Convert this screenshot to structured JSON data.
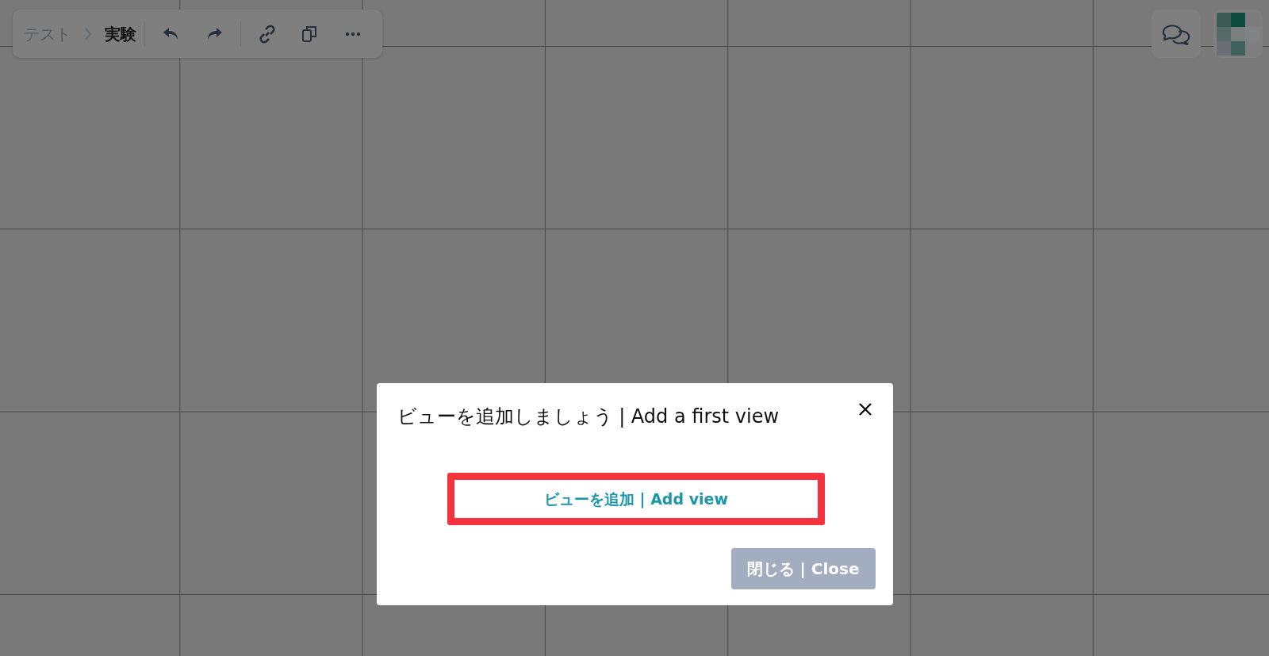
{
  "toolbar": {
    "breadcrumb": [
      {
        "label": "テスト",
        "current": false
      },
      {
        "label": "実験",
        "current": true
      }
    ]
  },
  "dialog": {
    "title": "ビューを追加しましょう | Add a first view",
    "add_button": {
      "label": "ビューを追加 | Add view",
      "highlighted": true
    },
    "close_button": {
      "label": "閉じる | Close",
      "disabled": true
    }
  }
}
